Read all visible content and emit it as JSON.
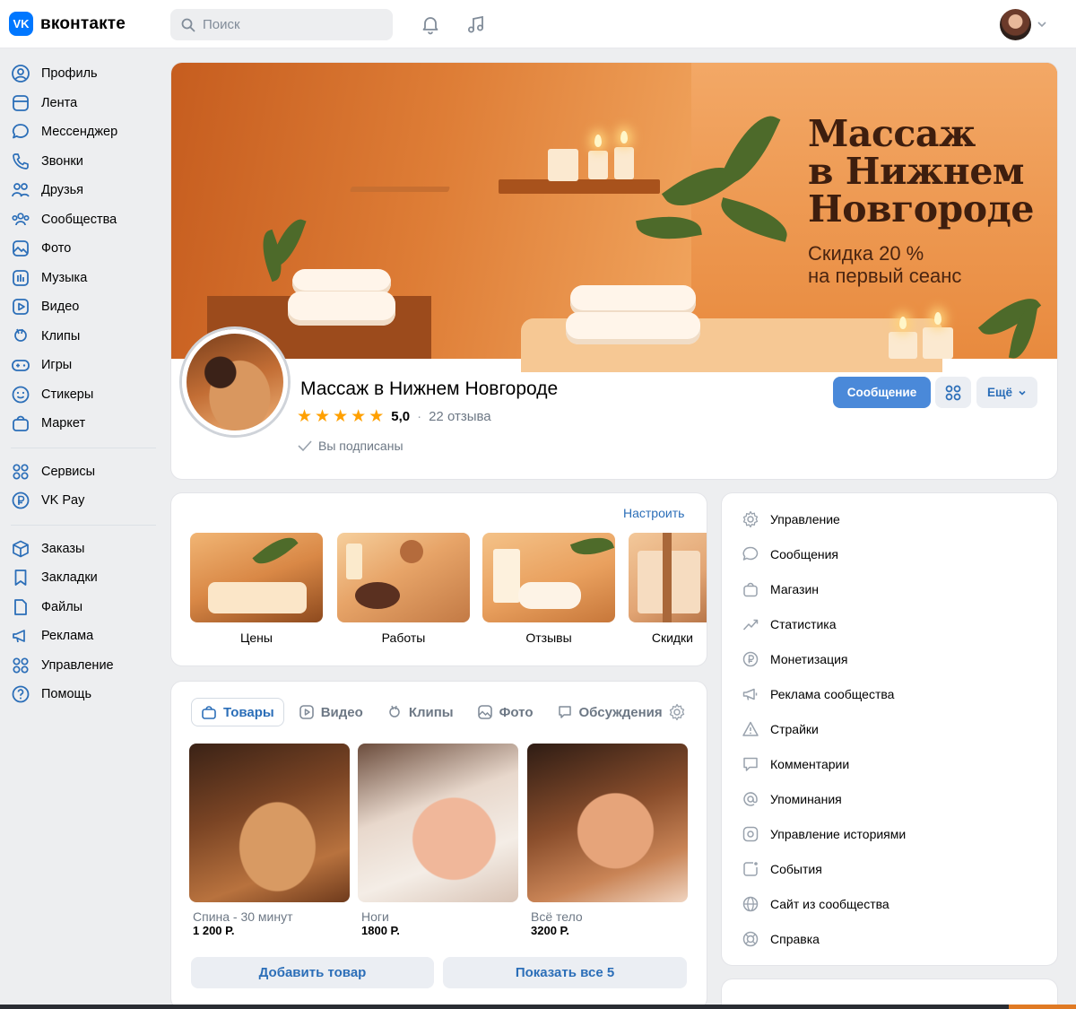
{
  "header": {
    "logo_badge": "VK",
    "logo_text": "вконтакте",
    "search_placeholder": "Поиск"
  },
  "sidebar": {
    "items": [
      {
        "label": "Профиль",
        "icon": "profile-icon"
      },
      {
        "label": "Лента",
        "icon": "feed-icon"
      },
      {
        "label": "Мессенджер",
        "icon": "messenger-icon"
      },
      {
        "label": "Звонки",
        "icon": "phone-icon"
      },
      {
        "label": "Друзья",
        "icon": "friends-icon"
      },
      {
        "label": "Сообщества",
        "icon": "communities-icon"
      },
      {
        "label": "Фото",
        "icon": "photo-icon"
      },
      {
        "label": "Музыка",
        "icon": "music-icon"
      },
      {
        "label": "Видео",
        "icon": "video-icon"
      },
      {
        "label": "Клипы",
        "icon": "clips-icon"
      },
      {
        "label": "Игры",
        "icon": "games-icon"
      },
      {
        "label": "Стикеры",
        "icon": "stickers-icon"
      },
      {
        "label": "Маркет",
        "icon": "market-icon"
      }
    ],
    "items2": [
      {
        "label": "Сервисы",
        "icon": "services-icon"
      },
      {
        "label": "VK Pay",
        "icon": "vkpay-icon"
      }
    ],
    "items3": [
      {
        "label": "Заказы",
        "icon": "orders-icon"
      },
      {
        "label": "Закладки",
        "icon": "bookmarks-icon"
      },
      {
        "label": "Файлы",
        "icon": "files-icon"
      },
      {
        "label": "Реклама",
        "icon": "ads-icon"
      },
      {
        "label": "Управление",
        "icon": "manage-icon"
      },
      {
        "label": "Помощь",
        "icon": "help-icon"
      }
    ]
  },
  "cover": {
    "title_line1": "Массаж",
    "title_line2": "в Нижнем",
    "title_line3": "Новгороде",
    "sub_line1": "Скидка 20 %",
    "sub_line2": "на первый сеанс"
  },
  "profile": {
    "name": "Массаж в Нижнем Новгороде",
    "rating": "5,0",
    "stars": 5,
    "reviews": "22 отзыва",
    "subscribed": "Вы подписаны",
    "btn_message": "Сообщение",
    "btn_more": "Ещё"
  },
  "menu": {
    "configure": "Настроить",
    "tiles": [
      {
        "label": "Цены"
      },
      {
        "label": "Работы"
      },
      {
        "label": "Отзывы"
      },
      {
        "label": "Скидки"
      }
    ]
  },
  "goods": {
    "tabs": [
      "Товары",
      "Видео",
      "Клипы",
      "Фото",
      "Обсуждения"
    ],
    "products": [
      {
        "name": "Спина - 30 минут",
        "price": "1 200 Р."
      },
      {
        "name": "Ноги",
        "price": "1800 Р."
      },
      {
        "name": "Всё тело",
        "price": "3200 Р."
      }
    ],
    "add_button": "Добавить товар",
    "show_all_button": "Показать все 5"
  },
  "admin": {
    "items": [
      {
        "label": "Управление",
        "icon": "gear-icon"
      },
      {
        "label": "Сообщения",
        "icon": "message-icon"
      },
      {
        "label": "Магазин",
        "icon": "shop-icon"
      },
      {
        "label": "Статистика",
        "icon": "stats-icon"
      },
      {
        "label": "Монетизация",
        "icon": "monetization-icon"
      },
      {
        "label": "Реклама сообщества",
        "icon": "megaphone-icon"
      },
      {
        "label": "Страйки",
        "icon": "warning-icon"
      },
      {
        "label": "Комментарии",
        "icon": "comment-icon"
      },
      {
        "label": "Упоминания",
        "icon": "at-icon"
      },
      {
        "label": "Управление историями",
        "icon": "stories-icon"
      },
      {
        "label": "События",
        "icon": "events-icon"
      },
      {
        "label": "Сайт из сообщества",
        "icon": "globe-icon"
      },
      {
        "label": "Справка",
        "icon": "help-circle-icon"
      }
    ]
  },
  "colors": {
    "accent": "#2b6eb8",
    "primary_button": "#4a89d9",
    "star": "#ffa000",
    "page_bg": "#edeef0"
  }
}
